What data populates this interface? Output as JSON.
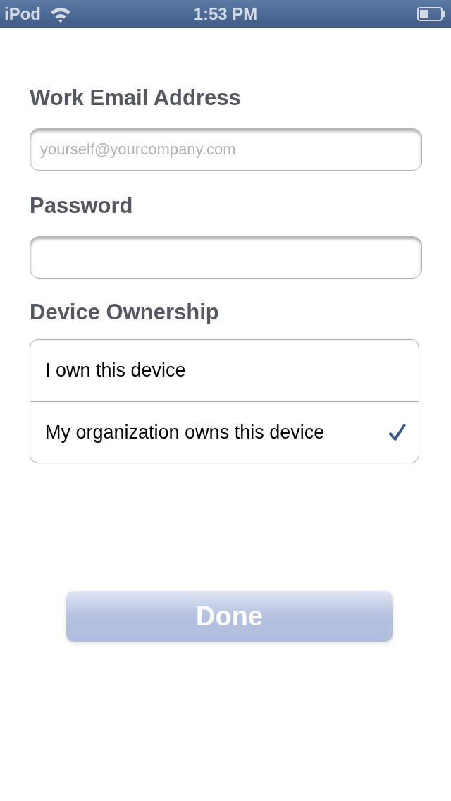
{
  "status_bar": {
    "carrier": "iPod",
    "time": "1:53 PM"
  },
  "fields": [
    {
      "label": "Work Email Address",
      "placeholder": "yourself@yourcompany.com"
    },
    {
      "label": "Password"
    }
  ],
  "ownership": {
    "label": "Device Ownership",
    "options": [
      {
        "label": "I own this device",
        "selected": false
      },
      {
        "label": "My organization owns this device",
        "selected": true
      }
    ]
  },
  "done_button": {
    "label": "Done",
    "disabled": true
  }
}
